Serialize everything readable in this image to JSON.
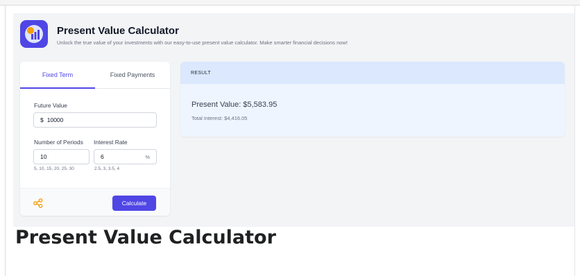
{
  "header": {
    "title": "Present Value Calculator",
    "subtitle": "Unlock the true value of your investments with our easy-to-use present value calculator. Make smarter financial decisions now!"
  },
  "tabs": [
    {
      "label": "Fixed Term",
      "active": true
    },
    {
      "label": "Fixed Payments",
      "active": false
    }
  ],
  "form": {
    "future_value_label": "Future Value",
    "currency_symbol": "$",
    "future_value": "10000",
    "periods_label": "Number of Periods",
    "periods_value": "10",
    "periods_hint": "5, 10, 15, 20, 25, 30",
    "rate_label": "Interest Rate",
    "rate_value": "6",
    "rate_unit": "%",
    "rate_hint": "2.5, 3, 3.5, 4"
  },
  "footer": {
    "share_icon": "share-icon",
    "calculate_label": "Calculate"
  },
  "result": {
    "heading": "RESULT",
    "present_value": "Present Value: $5,583.95",
    "total_interest": "Total Interest: $4,416.05"
  },
  "caption": "Present Value Calculator",
  "colors": {
    "accent": "#4f46e5",
    "share": "#f59e0b",
    "result_head": "#dbe8fd",
    "result_body": "#eff5ff"
  }
}
